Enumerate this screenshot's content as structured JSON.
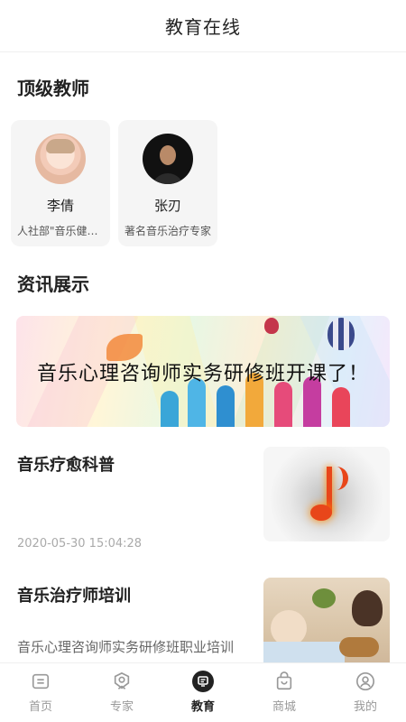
{
  "header": {
    "title": "教育在线"
  },
  "teachers_section": {
    "title": "顶级教师",
    "items": [
      {
        "name": "李倩",
        "desc": "人社部\"音乐健康指导师\""
      },
      {
        "name": "张刃",
        "desc": "著名音乐治疗专家"
      }
    ]
  },
  "news_section": {
    "title": "资讯展示",
    "banner_text": "音乐心理咨询师实务研修班开课了！",
    "items": [
      {
        "title": "音乐疗愈科普",
        "date": "2020-05-30 15:04:28"
      },
      {
        "title": "音乐治疗师培训",
        "desc": "音乐心理咨询师实务研修班职业培训"
      }
    ]
  },
  "tabbar": {
    "items": [
      {
        "label": "首页",
        "icon": "home-icon"
      },
      {
        "label": "专家",
        "icon": "expert-badge-icon"
      },
      {
        "label": "教育",
        "icon": "education-icon",
        "active": true
      },
      {
        "label": "商城",
        "icon": "shop-bag-icon"
      },
      {
        "label": "我的",
        "icon": "user-icon"
      }
    ]
  },
  "colors": {
    "active_tab": "#222222",
    "inactive_tab": "#999999",
    "card_bg": "#f5f5f5"
  }
}
